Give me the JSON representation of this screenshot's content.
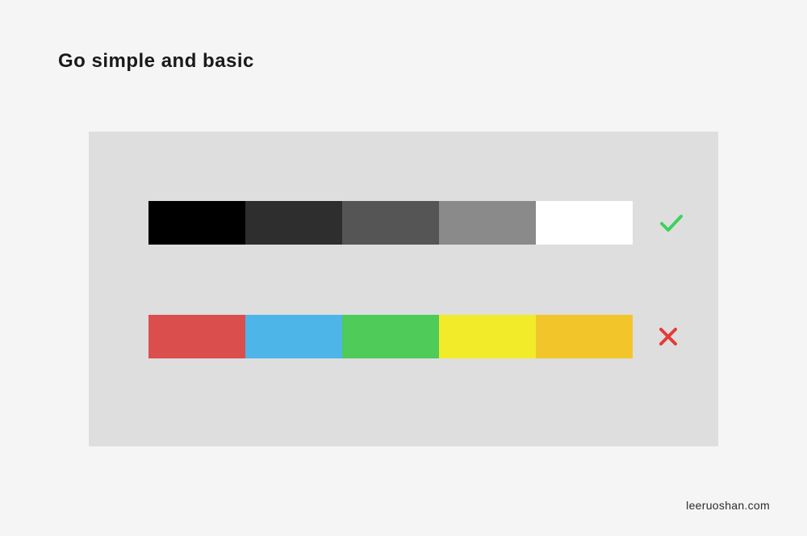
{
  "title": "Go simple and basic",
  "footer": "leeruoshan.com",
  "palettes": {
    "good": {
      "status": "check",
      "colors": [
        "#000000",
        "#2e2e2e",
        "#555555",
        "#8a8a8a",
        "#ffffff"
      ]
    },
    "bad": {
      "status": "cross",
      "colors": [
        "#db4e4e",
        "#4eb5e8",
        "#4ecb59",
        "#f2eb2a",
        "#f2c62a"
      ]
    }
  },
  "icon_colors": {
    "check": "#3dd15c",
    "cross": "#e43a3a"
  }
}
